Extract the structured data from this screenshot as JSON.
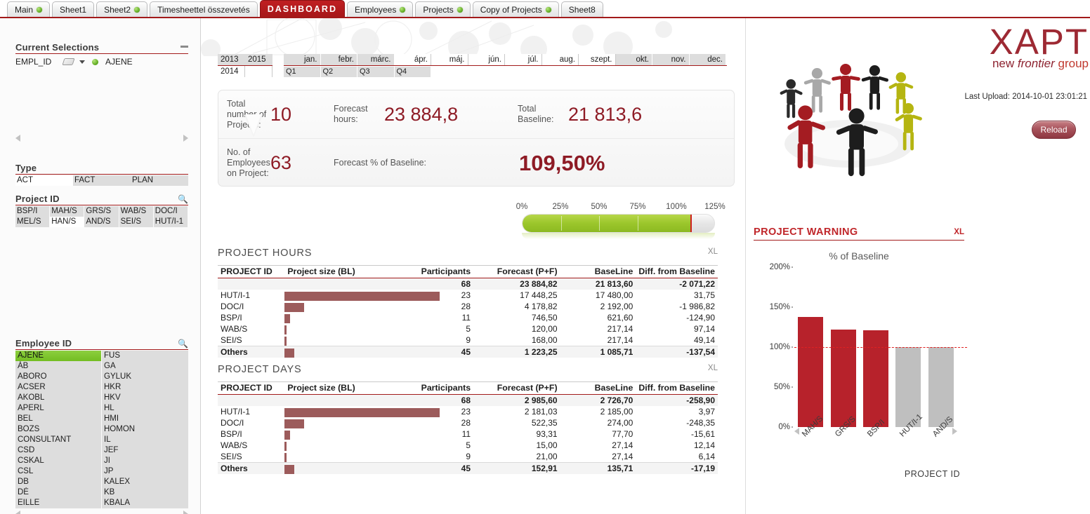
{
  "tabs": [
    {
      "label": "Main",
      "dot": true,
      "active": false
    },
    {
      "label": "Sheet1",
      "dot": false,
      "active": false
    },
    {
      "label": "Sheet2",
      "dot": true,
      "active": false
    },
    {
      "label": "Timesheettel összevetés",
      "dot": false,
      "active": false
    },
    {
      "label": "DASHBOARD",
      "dot": false,
      "active": true
    },
    {
      "label": "Employees",
      "dot": true,
      "active": false
    },
    {
      "label": "Projects",
      "dot": true,
      "active": false
    },
    {
      "label": "Copy of Projects",
      "dot": true,
      "active": false
    },
    {
      "label": "Sheet8",
      "dot": false,
      "active": false
    }
  ],
  "current_selections": {
    "title": "Current Selections",
    "rows": [
      {
        "field": "EMPL_ID",
        "value": "AJENE"
      }
    ]
  },
  "type_box": {
    "title": "Type",
    "values": [
      {
        "label": "ACT",
        "state": "white"
      },
      {
        "label": "FACT",
        "state": "grey"
      },
      {
        "label": "PLAN",
        "state": "grey"
      }
    ]
  },
  "project_id_box": {
    "title": "Project ID",
    "values": [
      {
        "label": "BSP/I",
        "state": "grey"
      },
      {
        "label": "MAH/S",
        "state": "grey"
      },
      {
        "label": "GRS/S",
        "state": "grey"
      },
      {
        "label": "WAB/S",
        "state": "grey"
      },
      {
        "label": "DOC/I",
        "state": "grey"
      },
      {
        "label": "MEL/S",
        "state": "grey"
      },
      {
        "label": "HAN/S",
        "state": "white"
      },
      {
        "label": "AND/S",
        "state": "grey"
      },
      {
        "label": "SEI/S",
        "state": "grey"
      },
      {
        "label": "HUT/I-1",
        "state": "grey"
      }
    ]
  },
  "employee_id_box": {
    "title": "Employee ID",
    "col1": [
      "AJENE",
      "ÁB",
      "ABORO",
      "ACSER",
      "AKOBL",
      "APERL",
      "BEL",
      "BOZS",
      "CONSULTANT",
      "CSD",
      "CSKAL",
      "CSL",
      "DB",
      "DÉ",
      "EILLE"
    ],
    "col2": [
      "FUS",
      "GA",
      "GYLUK",
      "HKR",
      "HKV",
      "HL",
      "HMI",
      "HOMON",
      "IL",
      "JEF",
      "JI",
      "JP",
      "KALEX",
      "KB",
      "KBALA"
    ],
    "selected": "AJENE"
  },
  "year_selector": {
    "cells": [
      {
        "label": "2013",
        "state": "grey"
      },
      {
        "label": "2015",
        "state": "grey"
      },
      {
        "label": "2014",
        "state": "white"
      },
      {
        "label": "",
        "state": "white"
      }
    ]
  },
  "month_selector": {
    "months": [
      {
        "label": "jan.",
        "state": "grey"
      },
      {
        "label": "febr.",
        "state": "grey"
      },
      {
        "label": "márc.",
        "state": "grey"
      },
      {
        "label": "ápr.",
        "state": "white"
      },
      {
        "label": "máj.",
        "state": "white"
      },
      {
        "label": "jún.",
        "state": "white"
      },
      {
        "label": "júl.",
        "state": "white"
      },
      {
        "label": "aug.",
        "state": "white"
      },
      {
        "label": "szept.",
        "state": "white"
      },
      {
        "label": "okt.",
        "state": "grey"
      },
      {
        "label": "nov.",
        "state": "grey"
      },
      {
        "label": "dec.",
        "state": "grey"
      }
    ],
    "quarters": [
      "Q1",
      "Q2",
      "Q3",
      "Q4"
    ]
  },
  "kpi": {
    "total_projects_label": "Total number of Projects:",
    "total_projects_value": "10",
    "forecast_hours_label": "Forecast hours:",
    "forecast_hours_value": "23 884,8",
    "total_baseline_label": "Total Baseline:",
    "total_baseline_value": "21 813,6",
    "employees_label": "No. of Employees on Project:",
    "employees_value": "63",
    "pct_label": "Forecast % of Baseline:",
    "pct_value": "109,50%"
  },
  "gauge": {
    "ticks": [
      "0%",
      "25%",
      "50%",
      "75%",
      "100%",
      "125%"
    ],
    "value_pct": 109.5,
    "max_pct": 125,
    "fill_color": "#9cc72c",
    "marker_color": "#d02020"
  },
  "project_hours": {
    "title": "PROJECT HOURS",
    "xl": "XL",
    "columns": [
      "PROJECT ID",
      "Project size (BL)",
      "Participants",
      "Forecast (P+F)",
      "BaseLine",
      "Diff. from Baseline"
    ],
    "total": {
      "participants": "68",
      "forecast": "23 884,82",
      "baseline": "21 813,60",
      "diff": "-2 071,22",
      "diff_neg": true
    },
    "rows": [
      {
        "id": "HUT/I-1",
        "bar": 100,
        "participants": "23",
        "forecast": "17 448,25",
        "baseline": "17 480,00",
        "diff": "31,75",
        "diff_neg": false
      },
      {
        "id": "DOC/I",
        "bar": 12.5,
        "participants": "28",
        "forecast": "4 178,82",
        "baseline": "2 192,00",
        "diff": "-1 986,82",
        "diff_neg": true
      },
      {
        "id": "BSP/I",
        "bar": 3.5,
        "participants": "11",
        "forecast": "746,50",
        "baseline": "621,60",
        "diff": "-124,90",
        "diff_neg": true
      },
      {
        "id": "WAB/S",
        "bar": 1.2,
        "participants": "5",
        "forecast": "120,00",
        "baseline": "217,14",
        "diff": "97,14",
        "diff_neg": false
      },
      {
        "id": "SEI/S",
        "bar": 1.2,
        "participants": "9",
        "forecast": "168,00",
        "baseline": "217,14",
        "diff": "49,14",
        "diff_neg": false
      }
    ],
    "others": {
      "id": "Others",
      "bar": 6.0,
      "participants": "45",
      "forecast": "1 223,25",
      "baseline": "1 085,71",
      "diff": "-137,54",
      "diff_neg": true
    }
  },
  "project_days": {
    "title": "PROJECT DAYS",
    "xl": "XL",
    "columns": [
      "PROJECT ID",
      "Project size (BL)",
      "Participants",
      "Forecast (P+F)",
      "BaseLine",
      "Diff. from Baseline"
    ],
    "total": {
      "participants": "68",
      "forecast": "2 985,60",
      "baseline": "2 726,70",
      "diff": "-258,90",
      "diff_neg": true
    },
    "rows": [
      {
        "id": "HUT/I-1",
        "bar": 100,
        "participants": "23",
        "forecast": "2 181,03",
        "baseline": "2 185,00",
        "diff": "3,97",
        "diff_neg": false
      },
      {
        "id": "DOC/I",
        "bar": 12.5,
        "participants": "28",
        "forecast": "522,35",
        "baseline": "274,00",
        "diff": "-248,35",
        "diff_neg": true
      },
      {
        "id": "BSP/I",
        "bar": 3.5,
        "participants": "11",
        "forecast": "93,31",
        "baseline": "77,70",
        "diff": "-15,61",
        "diff_neg": true
      },
      {
        "id": "WAB/S",
        "bar": 1.2,
        "participants": "5",
        "forecast": "15,00",
        "baseline": "27,14",
        "diff": "12,14",
        "diff_neg": false
      },
      {
        "id": "SEI/S",
        "bar": 1.2,
        "participants": "9",
        "forecast": "21,00",
        "baseline": "27,14",
        "diff": "6,14",
        "diff_neg": false
      }
    ],
    "others": {
      "id": "Others",
      "bar": 6.0,
      "participants": "45",
      "forecast": "152,91",
      "baseline": "135,71",
      "diff": "-17,19",
      "diff_neg": true
    }
  },
  "branding": {
    "logo_main": "XAPT",
    "logo_sub_1": "new ",
    "logo_sub_2": "frontier",
    "logo_sub_3": " group",
    "last_upload": "Last Upload: 2014-10-01 23:01:21",
    "reload_label": "Reload"
  },
  "project_warning": {
    "title": "PROJECT WARNING",
    "xl": "XL"
  },
  "chart_data": {
    "type": "bar",
    "title": "% of Baseline",
    "xlabel": "PROJECT ID",
    "ylabel": "",
    "categories": [
      "MAH/S",
      "GRS/S",
      "BSP/I",
      "HUT/I-1",
      "AND/S"
    ],
    "values": [
      138,
      122,
      121,
      100,
      100
    ],
    "colors": [
      "#b7222b",
      "#b7222b",
      "#b7222b",
      "#bfbfbf",
      "#bfbfbf"
    ],
    "ytick_labels": [
      "0%",
      "50%",
      "100%",
      "150%",
      "200%"
    ],
    "ytick_values": [
      0,
      50,
      100,
      150,
      200
    ],
    "ylim": [
      0,
      200
    ],
    "reference_line": {
      "value": 100,
      "color": "#e02121",
      "style": "dashed"
    },
    "grid": false,
    "legend": "none"
  }
}
